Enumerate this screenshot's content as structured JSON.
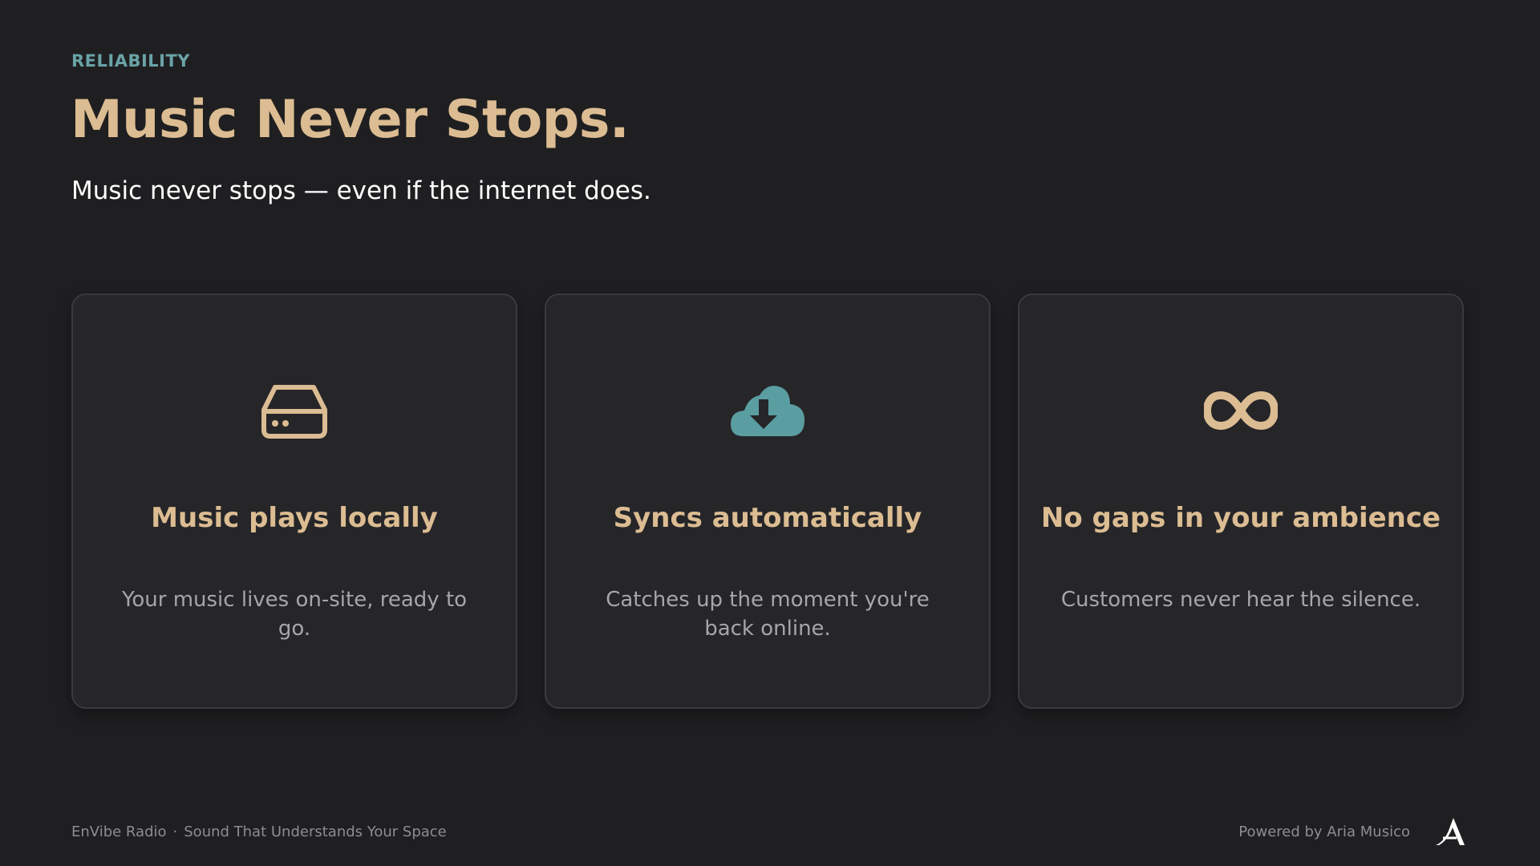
{
  "header": {
    "eyebrow": "RELIABILITY",
    "title": "Music Never Stops.",
    "subtitle": "Music never stops — even if the internet does."
  },
  "cards": [
    {
      "icon": "hard-drive-icon",
      "title": "Music plays locally",
      "description": "Your music lives on-site, ready to go."
    },
    {
      "icon": "cloud-download-icon",
      "title": "Syncs automatically",
      "description": "Catches up the moment you're back online."
    },
    {
      "icon": "infinity-icon",
      "title": "No gaps in your ambience",
      "description": "Customers never hear the silence."
    }
  ],
  "footer": {
    "brand": "EnVibe Radio",
    "separator": "·",
    "tagline": "Sound That Understands Your Space",
    "powered_by": "Powered by Aria Musico",
    "logo_icon": "aria-musico-logo-icon"
  },
  "colors": {
    "background": "#1f1f21",
    "accent_gold": "#dcbc92",
    "accent_teal": "#5b9ea2",
    "card_background": "#262629"
  }
}
